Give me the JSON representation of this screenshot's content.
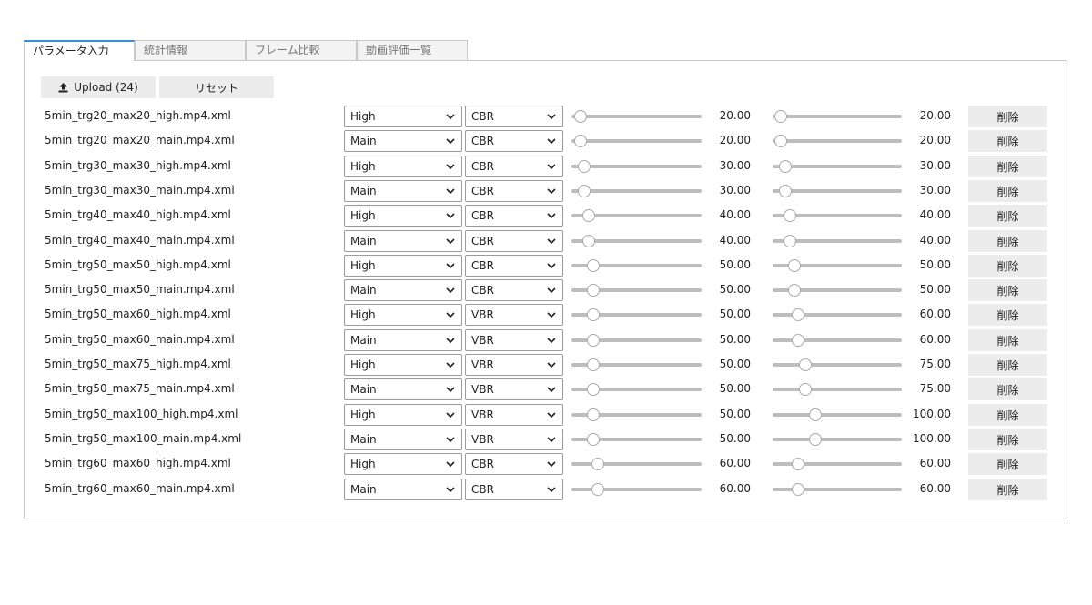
{
  "tabs": [
    {
      "label": "パラメータ入力",
      "active": true
    },
    {
      "label": "統計情報",
      "active": false
    },
    {
      "label": "フレーム比較",
      "active": false
    },
    {
      "label": "動画評価一覧",
      "active": false
    }
  ],
  "toolbar": {
    "upload_label": "Upload (24)",
    "reset_label": "リセット",
    "upload_icon": "upload-icon"
  },
  "slider_range": {
    "min": 0,
    "max": 300
  },
  "delete_label": "削除",
  "rows": [
    {
      "file": "5min_trg20_max20_high.mp4.xml",
      "profile": "High",
      "mode": "CBR",
      "target": "20.00",
      "max": "20.00",
      "target_value": 20,
      "max_value": 20
    },
    {
      "file": "5min_trg20_max20_main.mp4.xml",
      "profile": "Main",
      "mode": "CBR",
      "target": "20.00",
      "max": "20.00",
      "target_value": 20,
      "max_value": 20
    },
    {
      "file": "5min_trg30_max30_high.mp4.xml",
      "profile": "High",
      "mode": "CBR",
      "target": "30.00",
      "max": "30.00",
      "target_value": 30,
      "max_value": 30
    },
    {
      "file": "5min_trg30_max30_main.mp4.xml",
      "profile": "Main",
      "mode": "CBR",
      "target": "30.00",
      "max": "30.00",
      "target_value": 30,
      "max_value": 30
    },
    {
      "file": "5min_trg40_max40_high.mp4.xml",
      "profile": "High",
      "mode": "CBR",
      "target": "40.00",
      "max": "40.00",
      "target_value": 40,
      "max_value": 40
    },
    {
      "file": "5min_trg40_max40_main.mp4.xml",
      "profile": "Main",
      "mode": "CBR",
      "target": "40.00",
      "max": "40.00",
      "target_value": 40,
      "max_value": 40
    },
    {
      "file": "5min_trg50_max50_high.mp4.xml",
      "profile": "High",
      "mode": "CBR",
      "target": "50.00",
      "max": "50.00",
      "target_value": 50,
      "max_value": 50
    },
    {
      "file": "5min_trg50_max50_main.mp4.xml",
      "profile": "Main",
      "mode": "CBR",
      "target": "50.00",
      "max": "50.00",
      "target_value": 50,
      "max_value": 50
    },
    {
      "file": "5min_trg50_max60_high.mp4.xml",
      "profile": "High",
      "mode": "VBR",
      "target": "50.00",
      "max": "60.00",
      "target_value": 50,
      "max_value": 60
    },
    {
      "file": "5min_trg50_max60_main.mp4.xml",
      "profile": "Main",
      "mode": "VBR",
      "target": "50.00",
      "max": "60.00",
      "target_value": 50,
      "max_value": 60
    },
    {
      "file": "5min_trg50_max75_high.mp4.xml",
      "profile": "High",
      "mode": "VBR",
      "target": "50.00",
      "max": "75.00",
      "target_value": 50,
      "max_value": 75
    },
    {
      "file": "5min_trg50_max75_main.mp4.xml",
      "profile": "Main",
      "mode": "VBR",
      "target": "50.00",
      "max": "75.00",
      "target_value": 50,
      "max_value": 75
    },
    {
      "file": "5min_trg50_max100_high.mp4.xml",
      "profile": "High",
      "mode": "VBR",
      "target": "50.00",
      "max": "100.00",
      "target_value": 50,
      "max_value": 100
    },
    {
      "file": "5min_trg50_max100_main.mp4.xml",
      "profile": "Main",
      "mode": "VBR",
      "target": "50.00",
      "max": "100.00",
      "target_value": 50,
      "max_value": 100
    },
    {
      "file": "5min_trg60_max60_high.mp4.xml",
      "profile": "High",
      "mode": "CBR",
      "target": "60.00",
      "max": "60.00",
      "target_value": 60,
      "max_value": 60
    },
    {
      "file": "5min_trg60_max60_main.mp4.xml",
      "profile": "Main",
      "mode": "CBR",
      "target": "60.00",
      "max": "60.00",
      "target_value": 60,
      "max_value": 60
    }
  ]
}
